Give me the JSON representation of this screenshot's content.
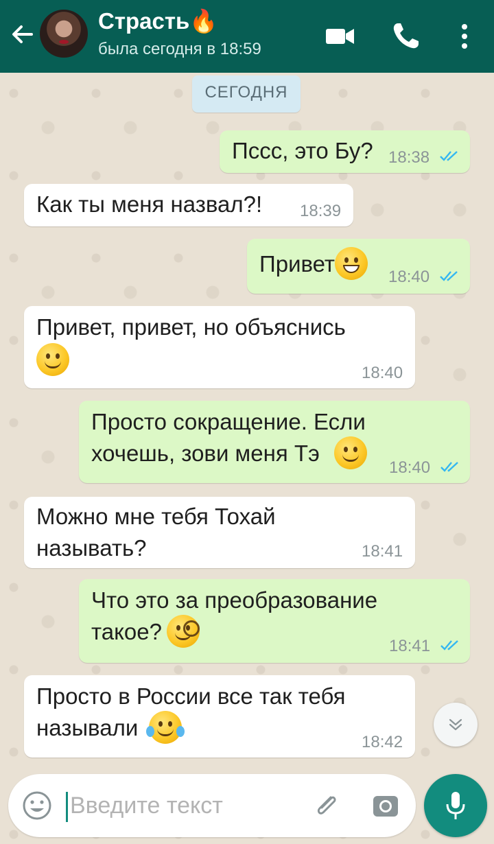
{
  "header": {
    "contact_name": "Страсть🔥",
    "last_seen": "была сегодня в 18:59",
    "icons": [
      "back-arrow-icon",
      "video-call-icon",
      "phone-icon",
      "more-vert-icon"
    ]
  },
  "chat": {
    "date_chip": "СЕГОДНЯ",
    "messages": [
      {
        "dir": "out",
        "text": "Пссс, это Бу?",
        "time": "18:38",
        "read": true
      },
      {
        "dir": "in",
        "text": "Как ты меня назвал?!",
        "time": "18:39"
      },
      {
        "dir": "out",
        "text": "Привет",
        "emoji": "grinning-face",
        "time": "18:40",
        "read": true
      },
      {
        "dir": "in",
        "text": "Привет, привет, но объяснись",
        "emoji": "slightly-smiling-face",
        "time": "18:40"
      },
      {
        "dir": "out",
        "text": "Просто сокращение. Если\nхочешь, зови меня Тэ",
        "emoji": "smiling-face",
        "time": "18:40",
        "read": true
      },
      {
        "dir": "in",
        "text": "Можно мне тебя Тохай\nназывать?",
        "time": "18:41"
      },
      {
        "dir": "out",
        "text": "Что это за преобразование\nтакое?",
        "emoji": "face-with-monocle",
        "time": "18:41",
        "read": true
      },
      {
        "dir": "in",
        "text": "Просто в России все так тебя\nназывали",
        "emoji": "tears-of-joy",
        "time": "18:42"
      }
    ]
  },
  "composer": {
    "placeholder": "Введите текст",
    "value": ""
  },
  "colors": {
    "header": "#075e54",
    "outgoing_bubble": "#dcf8c6",
    "incoming_bubble": "#ffffff",
    "read_ticks": "#34b7f1",
    "mic_button": "#128c7e"
  }
}
